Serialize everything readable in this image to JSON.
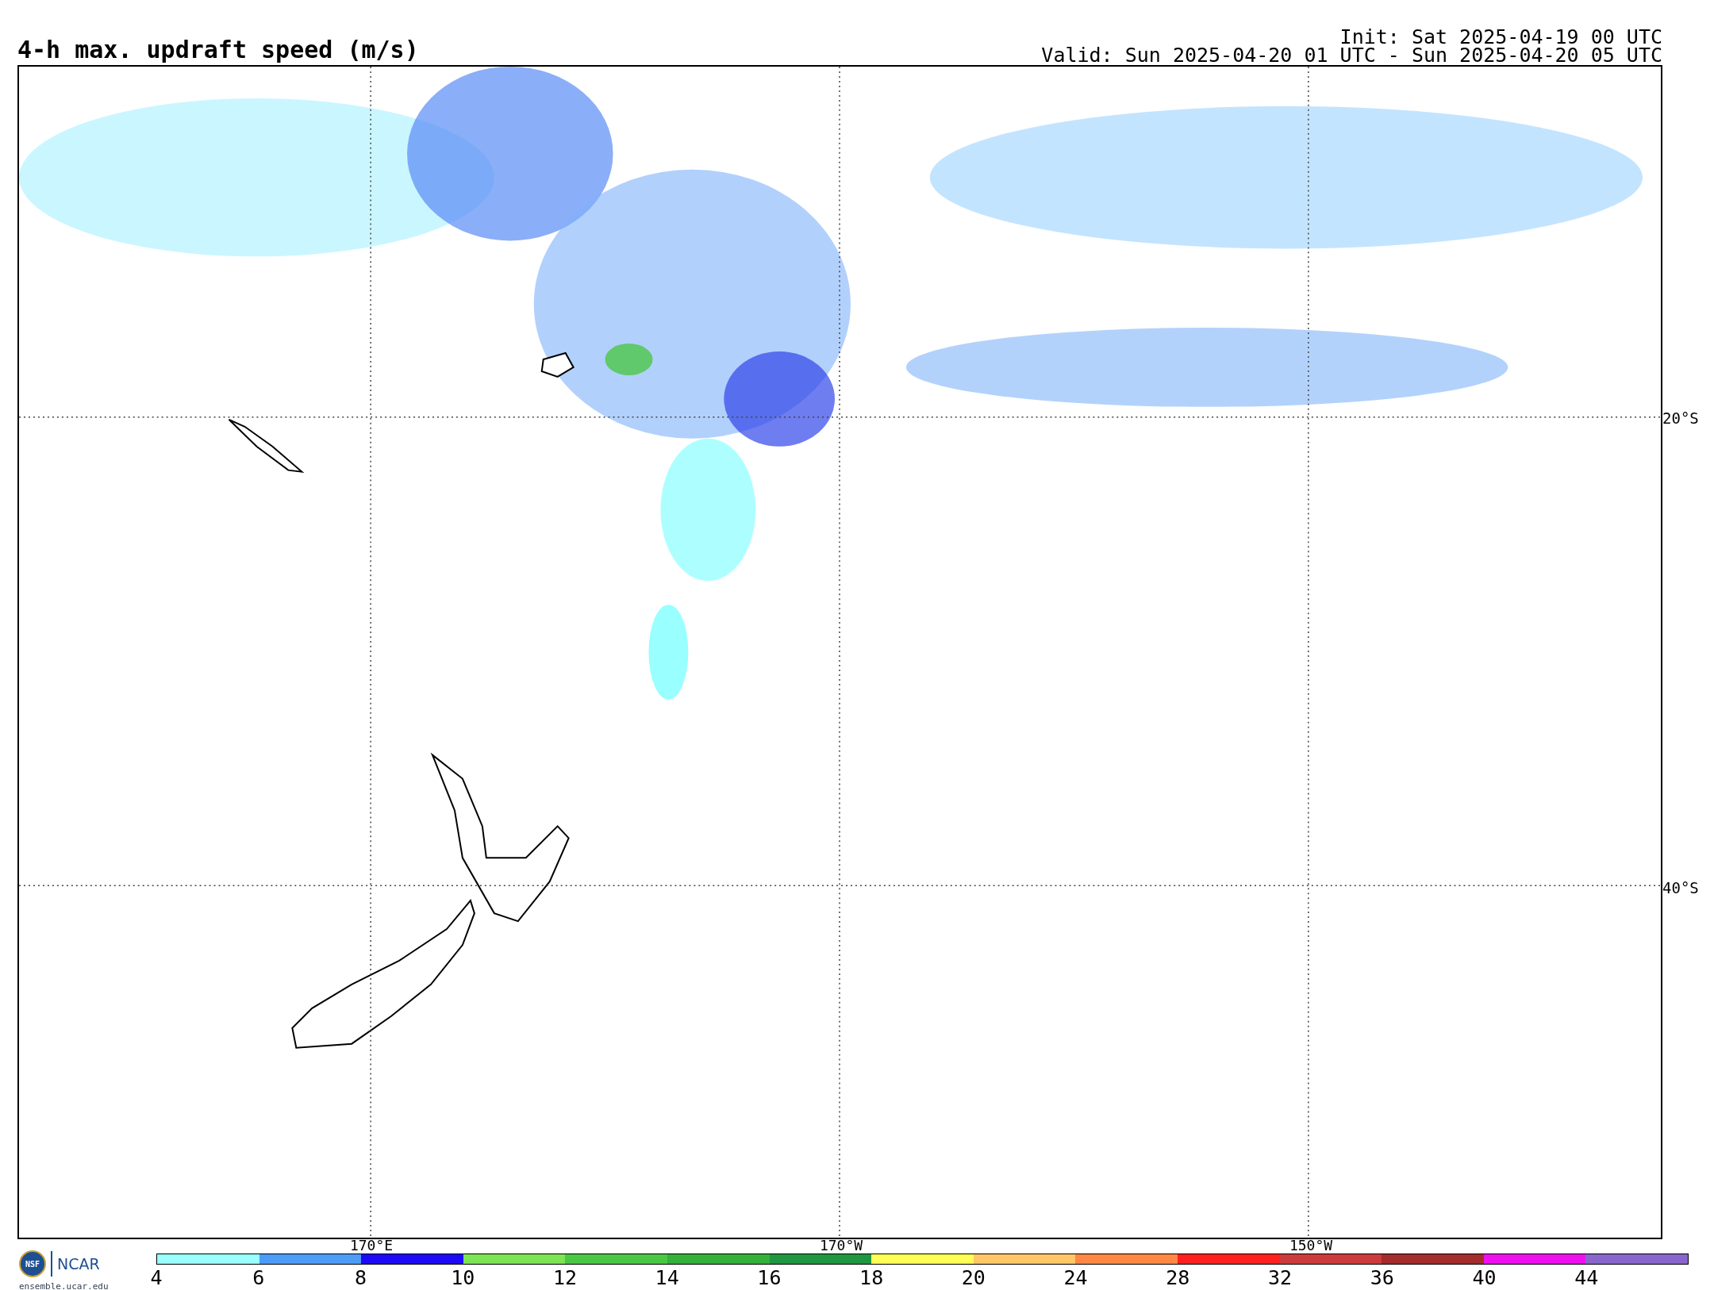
{
  "title": "4-h max. updraft speed (m/s)",
  "init": "Init: Sat 2025-04-19 00 UTC",
  "valid": "Valid: Sun 2025-04-20 01 UTC - Sun 2025-04-20 05 UTC",
  "map": {
    "longitude_labels": [
      "170°E",
      "170°W",
      "150°W"
    ],
    "latitude_labels": [
      "20°S",
      "40°S"
    ]
  },
  "logos": {
    "nsf": "NSF",
    "ncar": "NCAR",
    "site": "ensemble.ucar.edu"
  },
  "colorbar": [
    {
      "label": "4",
      "color": "#99ffff"
    },
    {
      "label": "6",
      "color": "#4c9cf7"
    },
    {
      "label": "8",
      "color": "#1e0af5"
    },
    {
      "label": "10",
      "color": "#7ee355"
    },
    {
      "label": "12",
      "color": "#4bc746"
    },
    {
      "label": "14",
      "color": "#35b03a"
    },
    {
      "label": "16",
      "color": "#1f9640"
    },
    {
      "label": "18",
      "color": "#ffff55"
    },
    {
      "label": "20",
      "color": "#ffc766"
    },
    {
      "label": "24",
      "color": "#ff8844"
    },
    {
      "label": "28",
      "color": "#ff2020"
    },
    {
      "label": "32",
      "color": "#cc3c3c"
    },
    {
      "label": "36",
      "color": "#a32c2c"
    },
    {
      "label": "40",
      "color": "#ee10ee"
    },
    {
      "label": "44",
      "color": "#8866cc"
    }
  ]
}
